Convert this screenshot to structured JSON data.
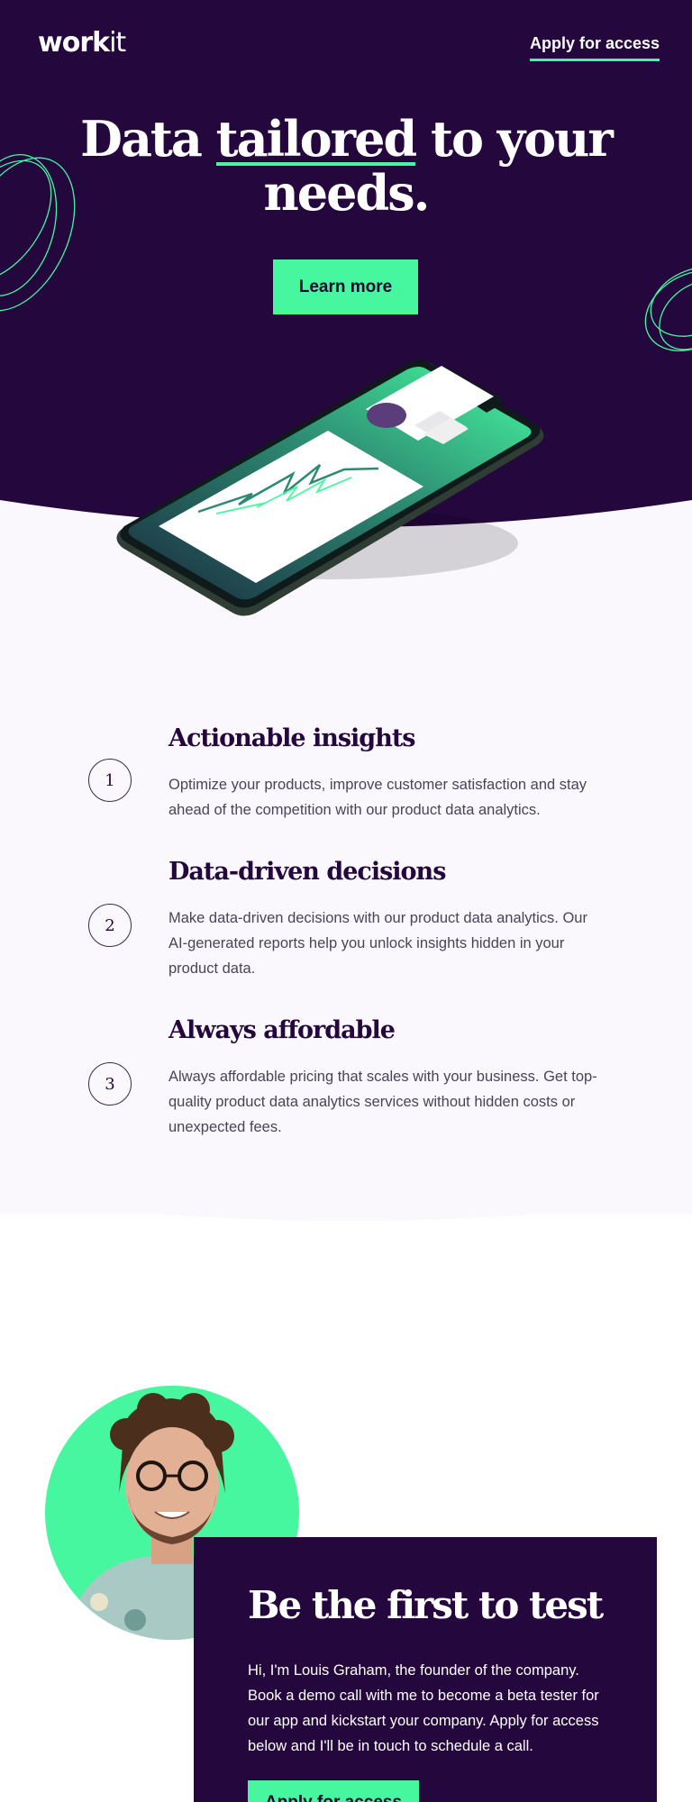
{
  "header": {
    "logo_bold": "work",
    "logo_light": "it",
    "apply_link": "Apply for access"
  },
  "hero": {
    "title_before": "Data ",
    "title_underlined": "tailored",
    "title_after": " to your needs.",
    "cta_label": "Learn more"
  },
  "features": [
    {
      "number": "1",
      "title": "Actionable insights",
      "text": "Optimize your products, improve customer satisfaction and stay ahead of the competition with our product data analytics."
    },
    {
      "number": "2",
      "title": "Data-driven decisions",
      "text": "Make data-driven decisions with our product data analytics. Our AI-generated reports help you unlock insights hidden in your product data."
    },
    {
      "number": "3",
      "title": "Always affordable",
      "text": "Always affordable pricing that scales with your business. Get top-quality product data analytics services without hidden costs or unexpected fees."
    }
  ],
  "founder": {
    "title": "Be the first to test",
    "text": "Hi, I'm Louis Graham, the founder of the company. Book a demo call with me to become a beta tester for our app and kickstart your company. Apply for access below and I'll be in touch to schedule a call.",
    "cta_label": "Apply for access"
  },
  "colors": {
    "dark_purple": "#24073c",
    "mint": "#46f7a0",
    "light_bg": "#faf7fd"
  }
}
